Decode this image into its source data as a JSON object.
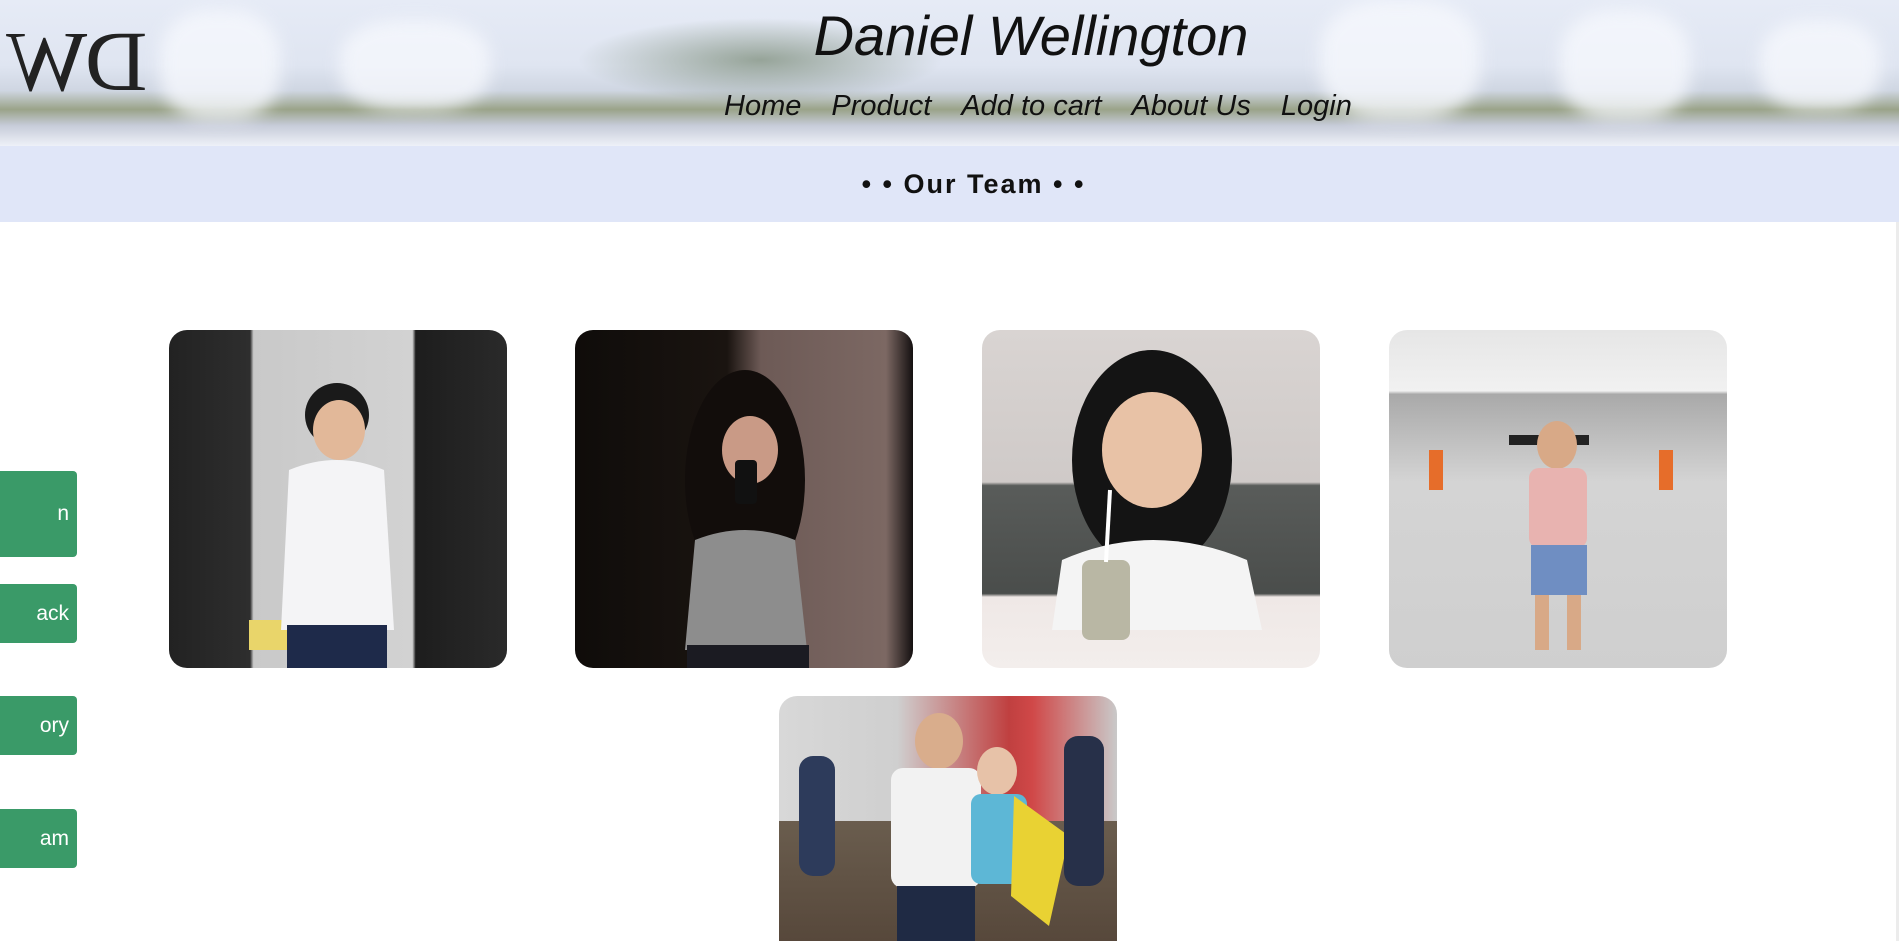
{
  "header": {
    "logo_text": "DW",
    "brand": "Daniel Wellington",
    "nav": [
      "Home",
      "Product",
      "Add to cart",
      "About Us",
      "Login"
    ]
  },
  "section": {
    "title": "• • Our Team • •"
  },
  "side_buttons": [
    "n",
    "ack",
    "ory",
    "am"
  ],
  "team_photos": [
    "team-photo-member-white-shirt",
    "team-photo-member-mirror-selfie",
    "team-photo-member-drink",
    "team-photo-member-carpark",
    "team-photo-group-event"
  ],
  "colors": {
    "section_bar": "#e0e6f8",
    "side_button": "#3a9a68",
    "text": "#111111"
  }
}
